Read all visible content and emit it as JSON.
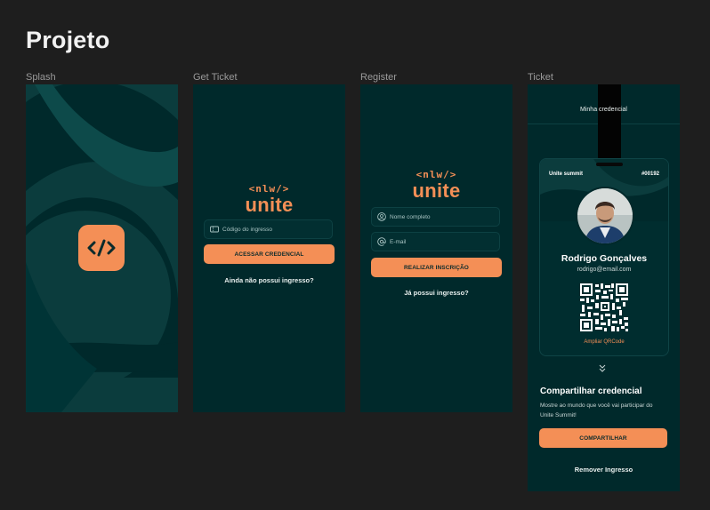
{
  "page": {
    "title": "Projeto"
  },
  "frames": {
    "splash": {
      "label": "Splash"
    },
    "get_ticket": {
      "label": "Get Ticket",
      "brand_tag": "<nlw/>",
      "brand_word": "unite",
      "ticket_code_placeholder": "Código do ingresso",
      "button_label": "ACESSAR CREDENCIAL",
      "link_label": "Ainda não possui ingresso?"
    },
    "register": {
      "label": "Register",
      "brand_tag": "<nlw/>",
      "brand_word": "unite",
      "name_placeholder": "Nome completo",
      "email_placeholder": "E-mail",
      "button_label": "REALIZAR INSCRIÇÃO",
      "link_label": "Já possui ingresso?"
    },
    "ticket": {
      "label": "Ticket",
      "header_title": "Minha credencial",
      "event_name": "Unite summit",
      "ticket_number": "#00192",
      "attendee_name": "Rodrigo Gonçalves",
      "attendee_email": "rodrigo@email.com",
      "qr_link": "Ampliar QRCode",
      "share_title": "Compartilhar credencial",
      "share_description": "Mostre ao mundo que você vai participar do Unite Summit!",
      "share_button": "COMPARTILHAR",
      "remove_label": "Remover Ingresso"
    }
  },
  "colors": {
    "background": "#1e1e1e",
    "frame_bg": "#00292b",
    "accent": "#f48f56",
    "pattern": "#0b3c3d"
  }
}
